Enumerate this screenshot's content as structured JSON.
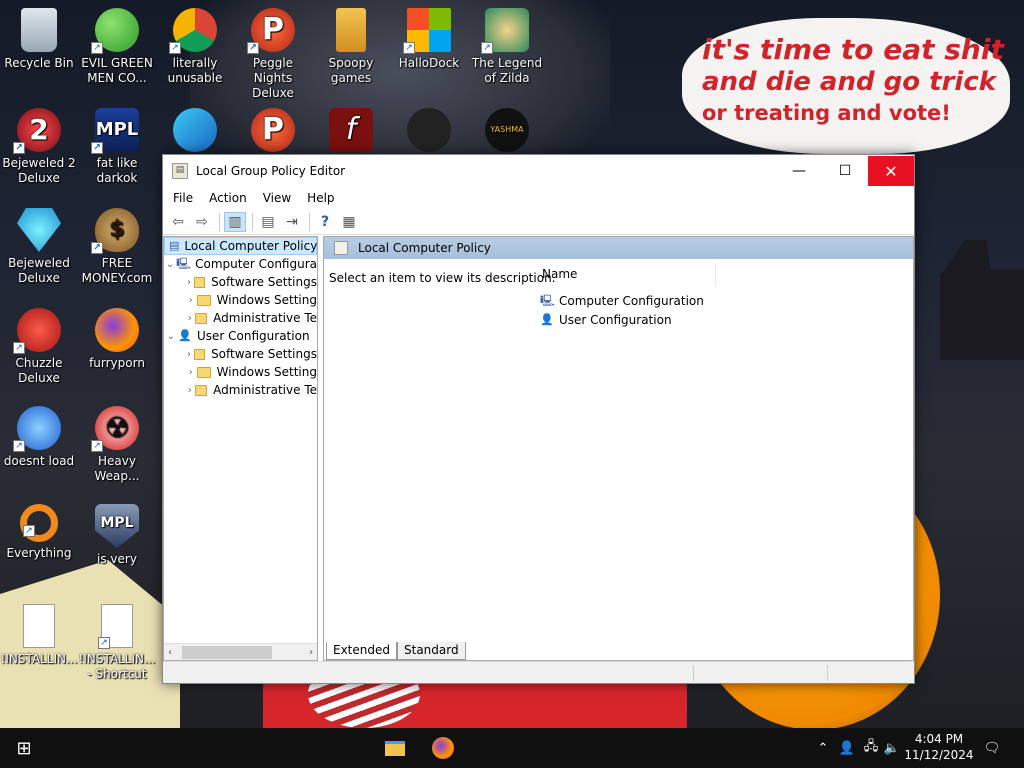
{
  "desktop": {
    "speech_bubble": {
      "line1": "it's time to eat shit",
      "line2": "and die and go trick",
      "line3": "or treating and vote!"
    },
    "icons": [
      {
        "label": "Recycle Bin",
        "icon": "recycle-bin-icon"
      },
      {
        "label": "EVIL GREEN MEN CO...",
        "icon": "green-men-icon"
      },
      {
        "label": "literally unusable",
        "icon": "chrome-icon"
      },
      {
        "label": "Peggle Nights Deluxe",
        "icon": "peggle-icon"
      },
      {
        "label": "Spoopy games",
        "icon": "folder-icon"
      },
      {
        "label": "HalloDock",
        "icon": "windows-icon"
      },
      {
        "label": "The Legend of Zilda",
        "icon": "zilda-icon"
      },
      {
        "label": "Bejeweled 2 Deluxe",
        "icon": "bejeweled2-icon"
      },
      {
        "label": "fat like darkok",
        "icon": "mpl-icon"
      },
      {
        "label": "Bejeweled Deluxe",
        "icon": "bejeweled-icon"
      },
      {
        "label": "FREE MONEY.com",
        "icon": "money-bag-icon"
      },
      {
        "label": "Chuzzle Deluxe",
        "icon": "chuzzle-icon"
      },
      {
        "label": "furryporn",
        "icon": "firefox-icon"
      },
      {
        "label": "doesnt load",
        "icon": "thunderbird-icon"
      },
      {
        "label": "Heavy Weap...",
        "icon": "radiation-icon"
      },
      {
        "label": "Everything",
        "icon": "search-icon"
      },
      {
        "label": "is very",
        "icon": "mpl-shield-icon"
      },
      {
        "label": "!INSTALLIN...",
        "icon": "text-file-icon"
      },
      {
        "label": "!INSTALLIN... - Shortcut",
        "icon": "text-file-icon"
      }
    ]
  },
  "window": {
    "title": "Local Group Policy Editor",
    "minimize": "—",
    "maximize": "☐",
    "close": "✕",
    "menu": [
      "File",
      "Action",
      "View",
      "Help"
    ],
    "tree": {
      "root": "Local Computer Policy",
      "computer": "Computer Configura",
      "computer_children": [
        "Software Settings",
        "Windows Setting",
        "Administrative Te"
      ],
      "user": "User Configuration",
      "user_children": [
        "Software Settings",
        "Windows Setting",
        "Administrative Te"
      ]
    },
    "right": {
      "header": "Local Computer Policy",
      "description": "Select an item to view its description.",
      "column_name": "Name",
      "items": [
        "Computer Configuration",
        "User Configuration"
      ]
    },
    "tabs": [
      "Extended",
      "Standard"
    ]
  },
  "taskbar": {
    "time": "4:04 PM",
    "date": "11/12/2024"
  }
}
